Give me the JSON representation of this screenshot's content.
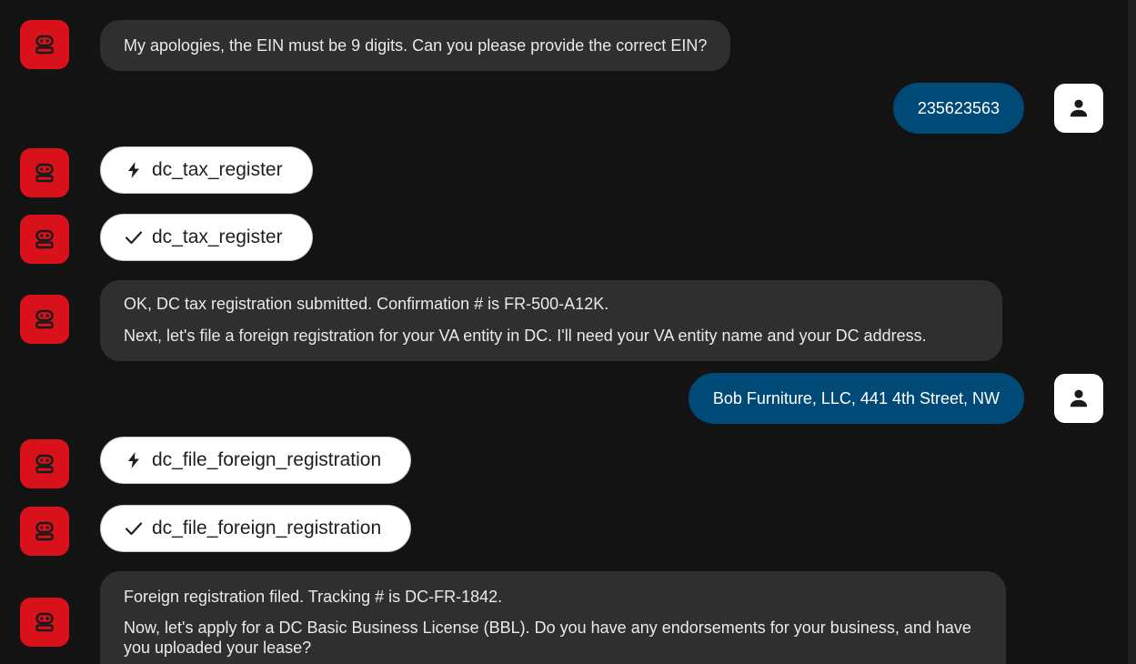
{
  "colors": {
    "background": "#131314",
    "bot_avatar": "#d8111b",
    "bot_bubble": "#2f2f30",
    "user_bubble": "#004a77",
    "tool_pill": "#ffffff"
  },
  "messages": [
    {
      "role": "bot",
      "kind": "text",
      "lines": [
        "My apologies, the EIN must be 9 digits. Can you please provide the correct EIN?"
      ]
    },
    {
      "role": "user",
      "kind": "text",
      "text": "235623563"
    },
    {
      "role": "bot",
      "kind": "tool_call",
      "icon": "bolt-icon",
      "text": "dc_tax_register"
    },
    {
      "role": "bot",
      "kind": "tool_result",
      "icon": "checkmark-icon",
      "text": "dc_tax_register"
    },
    {
      "role": "bot",
      "kind": "text",
      "lines": [
        "OK, DC tax registration submitted. Confirmation # is FR-500-A12K.",
        "Next, let's file a foreign registration for your VA entity in DC. I'll need your VA entity name and your DC address."
      ]
    },
    {
      "role": "user",
      "kind": "text",
      "text": "Bob Furniture, LLC, 441 4th Street, NW"
    },
    {
      "role": "bot",
      "kind": "tool_call",
      "icon": "bolt-icon",
      "text": "dc_file_foreign_registration"
    },
    {
      "role": "bot",
      "kind": "tool_result",
      "icon": "checkmark-icon",
      "text": "dc_file_foreign_registration"
    },
    {
      "role": "bot",
      "kind": "text",
      "lines": [
        "Foreign registration filed. Tracking # is DC-FR-1842.",
        "Now, let's apply for a DC Basic Business License (BBL). Do you have any endorsements for your business, and have you uploaded your lease?"
      ]
    }
  ]
}
